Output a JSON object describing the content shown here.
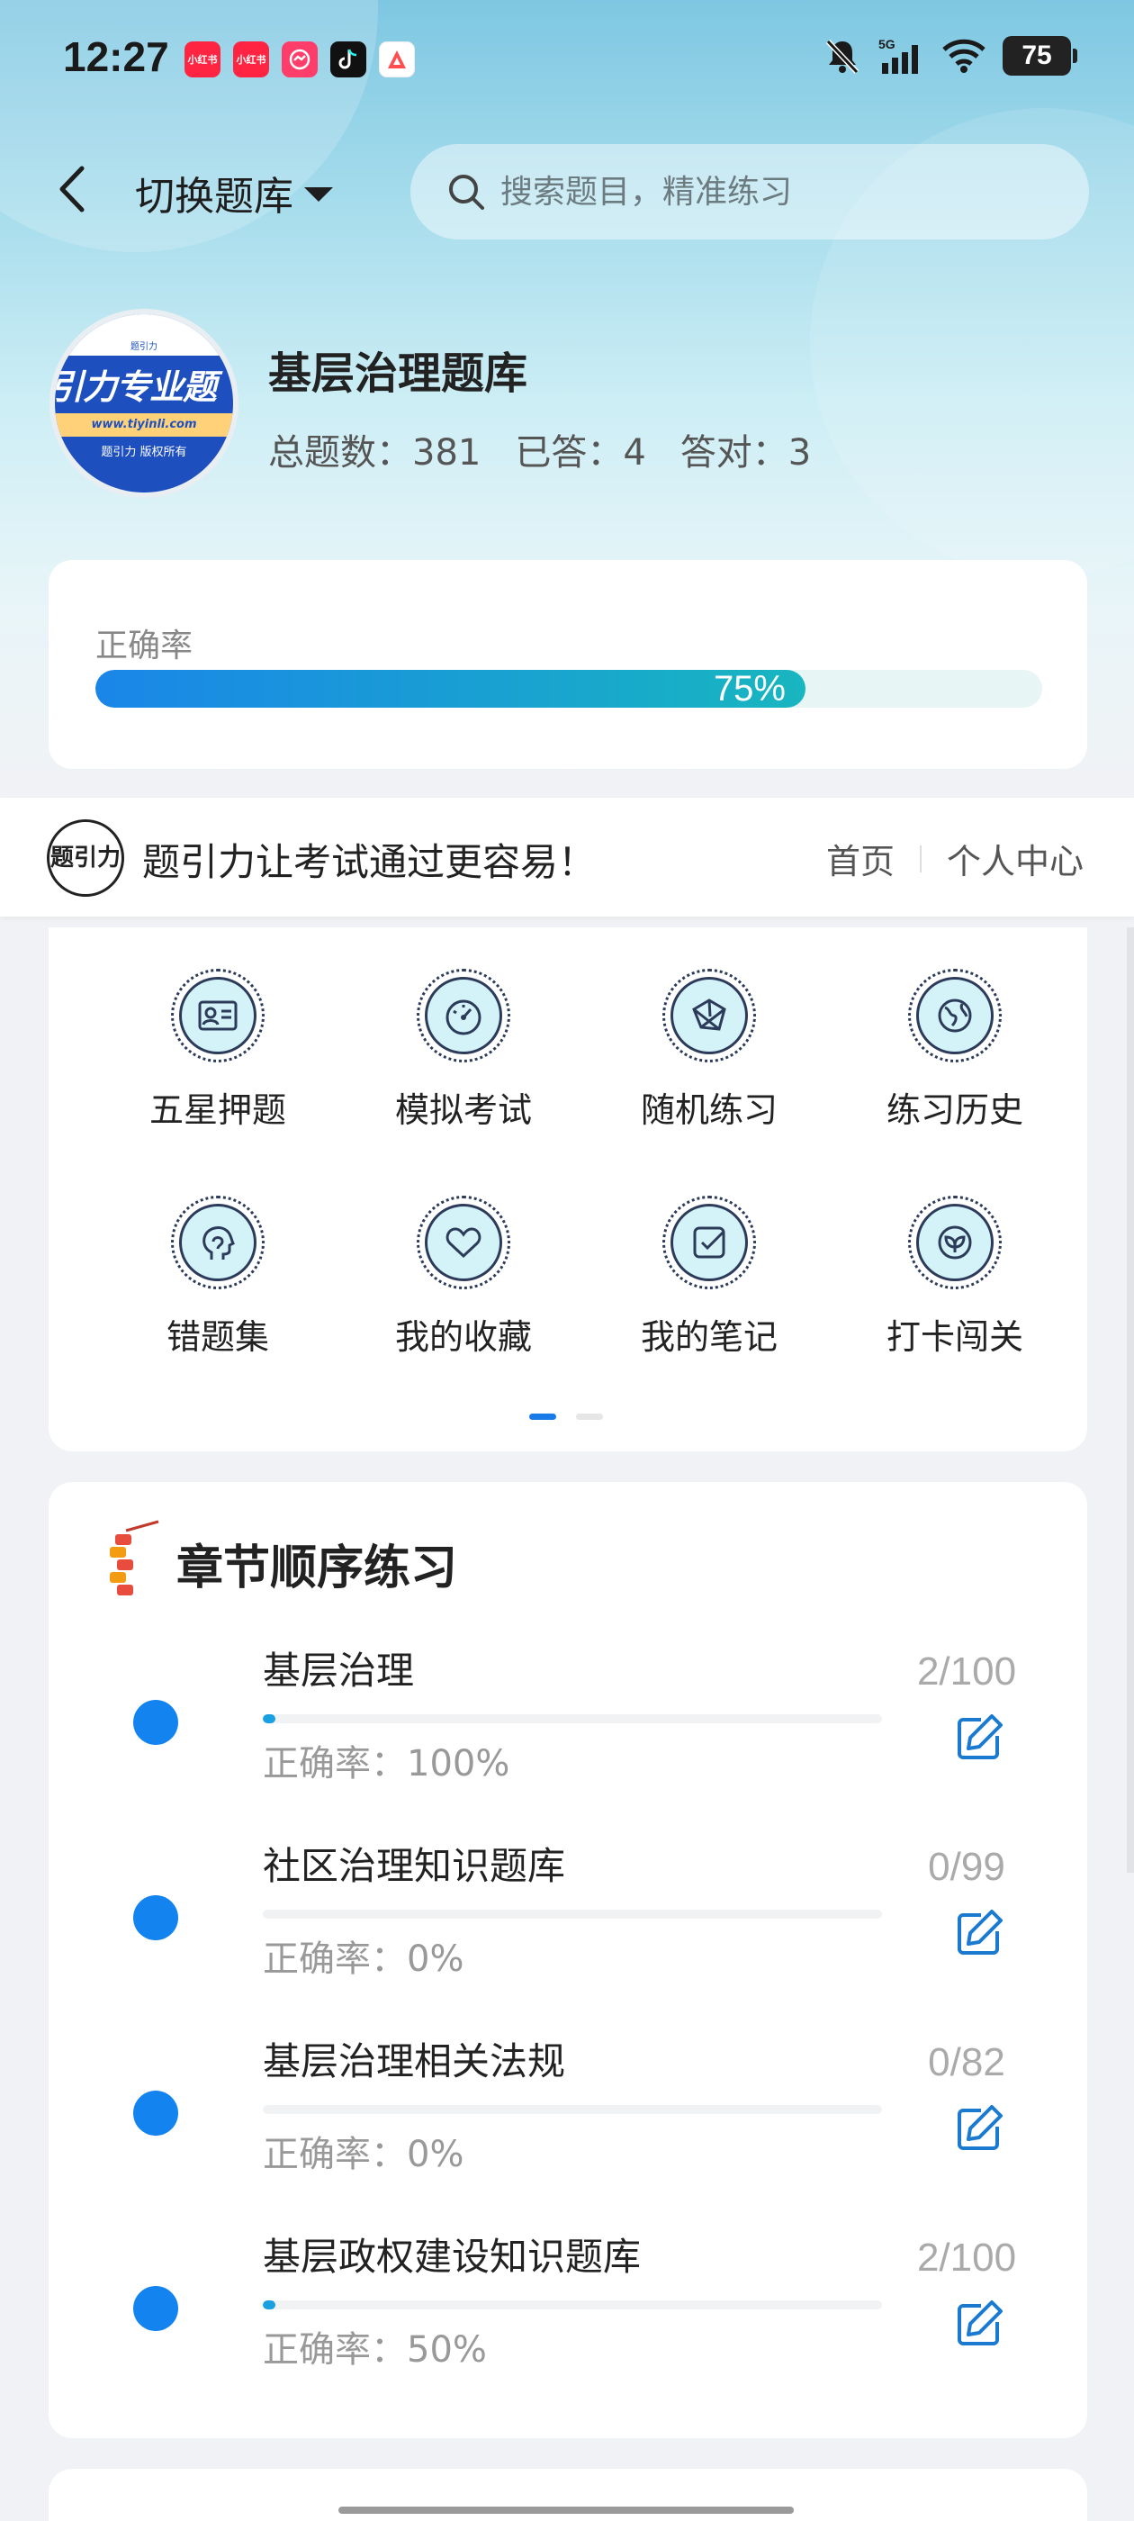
{
  "status_bar": {
    "time": "12:27",
    "apps": [
      {
        "name": "xiaohongshu-icon",
        "label": "小红书",
        "color": "#ff2442"
      },
      {
        "name": "xiaohongshu-icon-2",
        "label": "小红书",
        "color": "#ff2442"
      },
      {
        "name": "messenger-icon",
        "label": "",
        "color": "#ff3d6a"
      },
      {
        "name": "tiktok-icon",
        "label": "",
        "color": "#111111"
      },
      {
        "name": "app-a-icon",
        "label": "",
        "color": "#ff4d4f"
      }
    ],
    "network": "5G",
    "battery": "75"
  },
  "header": {
    "switch_label": "切换题库",
    "search_placeholder": "搜索题目，精准练习"
  },
  "bank": {
    "logo_text": "引力专业题",
    "logo_url": "www.tiyinli.com",
    "logo_copy": "题引力 版权所有",
    "logo_top": "题引力",
    "title": "基层治理题库",
    "total": "总题数：381",
    "answered": "已答：4",
    "correct": "答对：3"
  },
  "accuracy": {
    "label": "正确率",
    "value_text": "75%",
    "value": 0.75
  },
  "promo": {
    "logo_text": "题引力",
    "slogan": "题引力让考试通过更容易！",
    "link_home": "首页",
    "link_profile": "个人中心"
  },
  "features": [
    {
      "label": "五星押题",
      "icon": "id-card-icon"
    },
    {
      "label": "模拟考试",
      "icon": "speedometer-icon"
    },
    {
      "label": "随机练习",
      "icon": "network-icon"
    },
    {
      "label": "练习历史",
      "icon": "globe-icon"
    },
    {
      "label": "错题集",
      "icon": "head-icon"
    },
    {
      "label": "我的收藏",
      "icon": "heart-icon"
    },
    {
      "label": "我的笔记",
      "icon": "note-check-icon"
    },
    {
      "label": "打卡闯关",
      "icon": "leaf-icon"
    }
  ],
  "chapters": {
    "title": "章节顺序练习",
    "items": [
      {
        "name": "基层治理",
        "count": "2/100",
        "progress": 0.02,
        "accuracy": "正确率：100%"
      },
      {
        "name": "社区治理知识题库",
        "count": "0/99",
        "progress": 0,
        "accuracy": "正确率：0%"
      },
      {
        "name": "基层治理相关法规",
        "count": "0/82",
        "progress": 0,
        "accuracy": "正确率：0%"
      },
      {
        "name": "基层政权建设知识题库",
        "count": "2/100",
        "progress": 0.02,
        "accuracy": "正确率：50%"
      }
    ]
  }
}
